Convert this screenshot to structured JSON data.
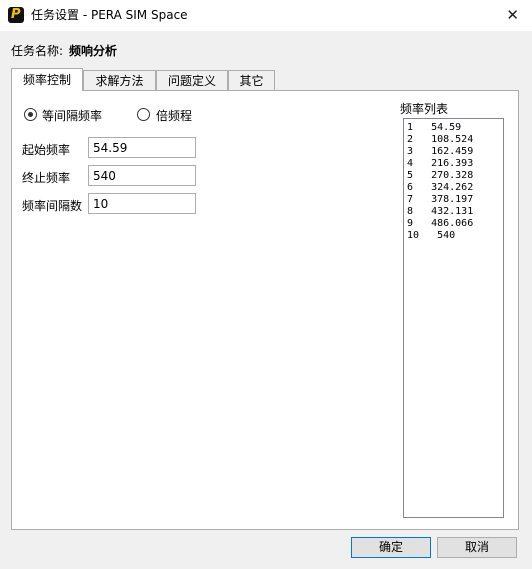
{
  "window": {
    "title": "任务设置 - PERA SIM Space",
    "close_glyph": "✕",
    "icon_letter": "P"
  },
  "task": {
    "label": "任务名称:",
    "value": "频响分析"
  },
  "tabs": [
    "频率控制",
    "求解方法",
    "问题定义",
    "其它"
  ],
  "frequency": {
    "radio_equal": "等间隔频率",
    "radio_octave": "倍频程",
    "start_label": "起始频率",
    "start_value": "54.59",
    "end_label": "终止频率",
    "end_value": "540",
    "count_label": "频率间隔数",
    "count_value": "10"
  },
  "list": {
    "title": "频率列表",
    "items": [
      "1   54.59",
      "2   108.524",
      "3   162.459",
      "4   216.393",
      "5   270.328",
      "6   324.262",
      "7   378.197",
      "8   432.131",
      "9   486.066",
      "10   540"
    ]
  },
  "buttons": {
    "ok": "确定",
    "cancel": "取消"
  }
}
